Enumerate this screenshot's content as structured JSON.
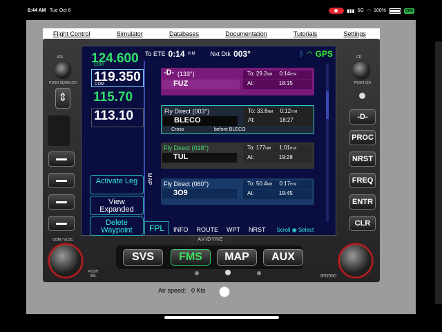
{
  "status_bar": {
    "time": "6:44 AM",
    "date": "Tue Oct 6",
    "signal": "5G",
    "battery": "100%",
    "charging": "CHG"
  },
  "menu": [
    "Flight Control",
    "Simulator",
    "Databases",
    "Documentation",
    "Tutorials",
    "Settings"
  ],
  "header": {
    "to_ete_label": "To ETE",
    "to_ete_value": "0:14",
    "to_ete_unit": "H:M",
    "nxt_dtk_label": "Nxt Dtk",
    "nxt_dtk_value": "003°",
    "gps": "GPS"
  },
  "frequencies": [
    {
      "value": "124.600",
      "tag": "COM",
      "color": "#2ee06a"
    },
    {
      "value": "119.350",
      "tag": "COM",
      "color": "#ffffff"
    },
    {
      "value": "115.70",
      "tag": "",
      "color": "#2ee06a"
    },
    {
      "value": "113.10",
      "tag": "",
      "color": "#ffffff"
    }
  ],
  "softkeys": {
    "activate": "Activate Leg",
    "view": "View Expanded",
    "delete": "Delete Waypoint",
    "map": "MAP"
  },
  "waypoints": [
    {
      "header": "(133°)",
      "ident": "FUZ",
      "to": "To: 29.2",
      "to_unit": "NM",
      "to_time": "0:14",
      "to_time_unit": "H M",
      "at": "At:",
      "at_time": "18:15"
    },
    {
      "header": "Fly Direct (003°)",
      "ident": "BLECO",
      "to": "To: 33.8",
      "to_unit": "NM",
      "to_time": "0:12",
      "to_time_unit": "H M",
      "at": "At:",
      "at_time": "18:27",
      "cross": "Cross",
      "before": "before BLECO"
    },
    {
      "header": "Fly Direct (018°)",
      "ident": "TUL",
      "to": "To: 177",
      "to_unit": "NM",
      "to_time": "1:01",
      "to_time_unit": "H M",
      "at": "At:",
      "at_time": "19:28"
    },
    {
      "header": "Fly Direct (060°)",
      "ident": "3O9",
      "to": "To: 50.4",
      "to_unit": "NM",
      "to_time": "0:17",
      "to_time_unit": "H M",
      "at": "At:",
      "at_time": "19:45"
    }
  ],
  "tabs": [
    "FPL",
    "INFO",
    "ROUTE",
    "WPT",
    "NRST"
  ],
  "scroll": {
    "label": "Scroll",
    "select": "Select"
  },
  "right_buttons": [
    "-D-",
    "PROC",
    "NRST",
    "FREQ",
    "ENTR",
    "CLR"
  ],
  "bottom_buttons": [
    "SVS",
    "FMS",
    "MAP",
    "AUX"
  ],
  "brand": "AVIDYNE",
  "model": "IFD550",
  "knob_labels": {
    "vol": "VOL",
    "push_squelch": "PUSH SQUELCH",
    "com_vloc": "COM / VLOC",
    "push_sel": "PUSH SEL",
    "cd": "CD",
    "push_cdi": "PUSH CDI"
  },
  "airspeed": {
    "label": "Air speed:",
    "value": "0 Kts"
  }
}
